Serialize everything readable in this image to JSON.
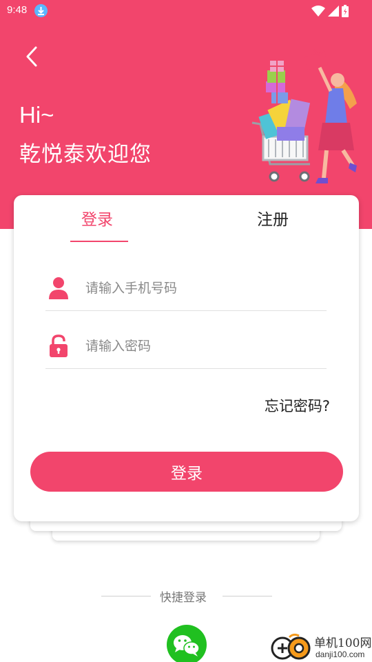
{
  "status_bar": {
    "time": "9:48"
  },
  "header": {
    "greeting": "Hi~",
    "welcome": "乾悦泰欢迎您"
  },
  "tabs": [
    {
      "label": "登录",
      "active": true
    },
    {
      "label": "注册",
      "active": false
    }
  ],
  "form": {
    "phone_placeholder": "请输入手机号码",
    "phone_value": "",
    "password_placeholder": "请输入密码",
    "password_value": "",
    "forgot_label": "忘记密码?",
    "submit_label": "登录"
  },
  "quick_login": {
    "label": "快捷登录"
  },
  "watermark": {
    "name": "单机100网",
    "url": "danji100.com"
  },
  "colors": {
    "accent": "#f2456c",
    "wechat": "#20c020"
  }
}
